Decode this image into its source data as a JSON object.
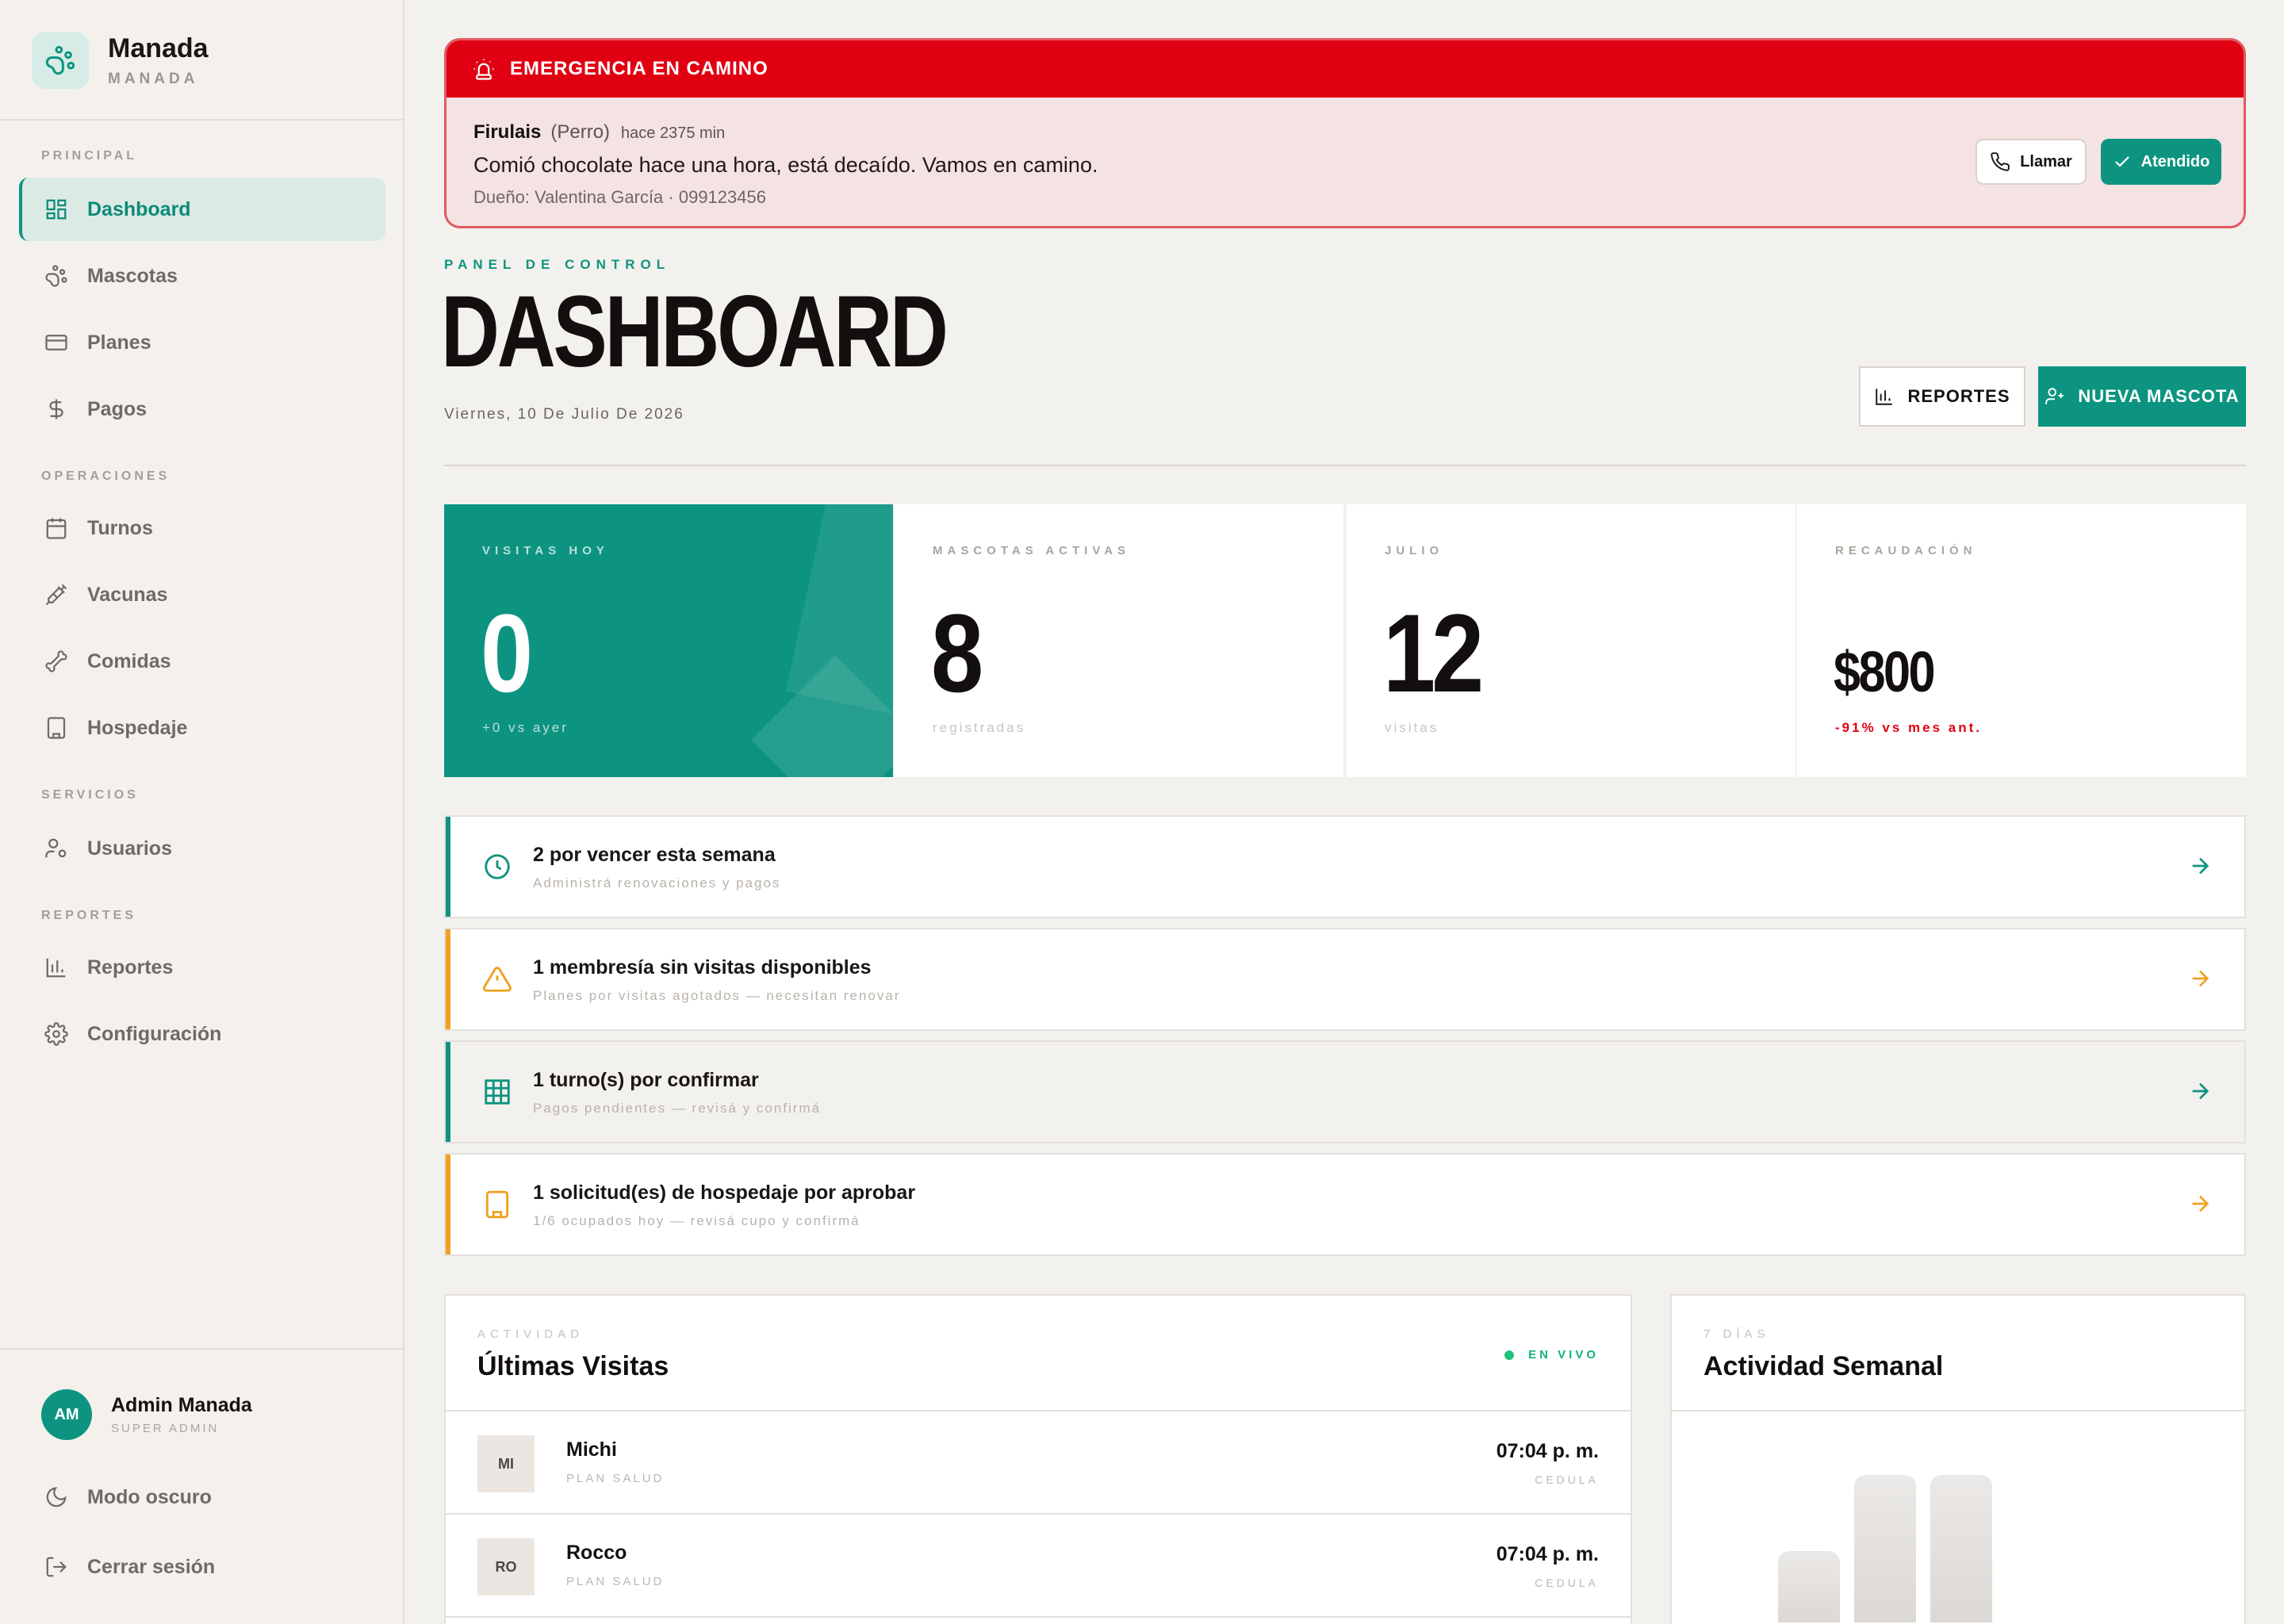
{
  "brand": {
    "name": "Manada",
    "subtitle": "MANADA"
  },
  "sidebar": {
    "sections": {
      "principal": "PRINCIPAL",
      "operaciones": "OPERACIONES",
      "servicios": "SERVICIOS",
      "reportes": "REPORTES"
    },
    "items": {
      "dashboard": "Dashboard",
      "mascotas": "Mascotas",
      "planes": "Planes",
      "pagos": "Pagos",
      "turnos": "Turnos",
      "vacunas": "Vacunas",
      "comidas": "Comidas",
      "hospedaje": "Hospedaje",
      "usuarios": "Usuarios",
      "reportes": "Reportes",
      "configuracion": "Configuración"
    },
    "active": "dashboard",
    "user": {
      "initials": "AM",
      "name": "Admin Manada",
      "role": "SUPER ADMIN"
    },
    "dark_mode": "Modo oscuro",
    "logout": "Cerrar sesión"
  },
  "emergency": {
    "title": "EMERGENCIA EN CAMINO",
    "pet_name": "Firulais",
    "pet_type": "(Perro)",
    "ago": "hace 2375 min",
    "message": "Comió chocolate hace una hora, está decaído. Vamos en camino.",
    "owner": "Dueño: Valentina García · 099123456",
    "call_label": "Llamar",
    "done_label": "Atendido"
  },
  "header": {
    "eyebrow": "PANEL DE CONTROL",
    "title": "DASHBOARD",
    "date": "Viernes, 10 De Julio De 2026",
    "reports_label": "REPORTES",
    "new_pet_label": "NUEVA MASCOTA"
  },
  "stats": [
    {
      "label": "VISITAS HOY",
      "value": "0",
      "sub": "+0 vs ayer"
    },
    {
      "label": "MASCOTAS ACTIVAS",
      "value": "8",
      "sub": "registradas"
    },
    {
      "label": "JULIO",
      "value": "12",
      "sub": "visitas"
    },
    {
      "label": "RECAUDACIÓN",
      "value": "$800",
      "sub": "-91% vs mes ant."
    }
  ],
  "notices": [
    {
      "title": "2 por vencer esta semana",
      "sub": "Administrá renovaciones y pagos"
    },
    {
      "title": "1 membresía sin visitas disponibles",
      "sub": "Planes por visitas agotados — necesitan renovar"
    },
    {
      "title": "1 turno(s) por confirmar",
      "sub": "Pagos pendientes — revisá y confirmá"
    },
    {
      "title": "1 solicitud(es) de hospedaje por aprobar",
      "sub": "1/6 ocupados hoy — revisá cupo y confirmá"
    }
  ],
  "colors": {
    "accent": "#0d9480",
    "warning": "#f0a020",
    "danger": "#e00012"
  },
  "visits_panel": {
    "eyebrow": "ACTIVIDAD",
    "title": "Últimas Visitas",
    "live": "EN VIVO",
    "rows": [
      {
        "initials": "MI",
        "name": "Michi",
        "plan": "PLAN SALUD",
        "time": "07:04 p. m.",
        "doc": "CEDULA"
      },
      {
        "initials": "RO",
        "name": "Rocco",
        "plan": "PLAN SALUD",
        "time": "07:04 p. m.",
        "doc": "CEDULA"
      }
    ]
  },
  "weekly_panel": {
    "eyebrow": "7 DÍAS",
    "title": "Actividad Semanal"
  }
}
